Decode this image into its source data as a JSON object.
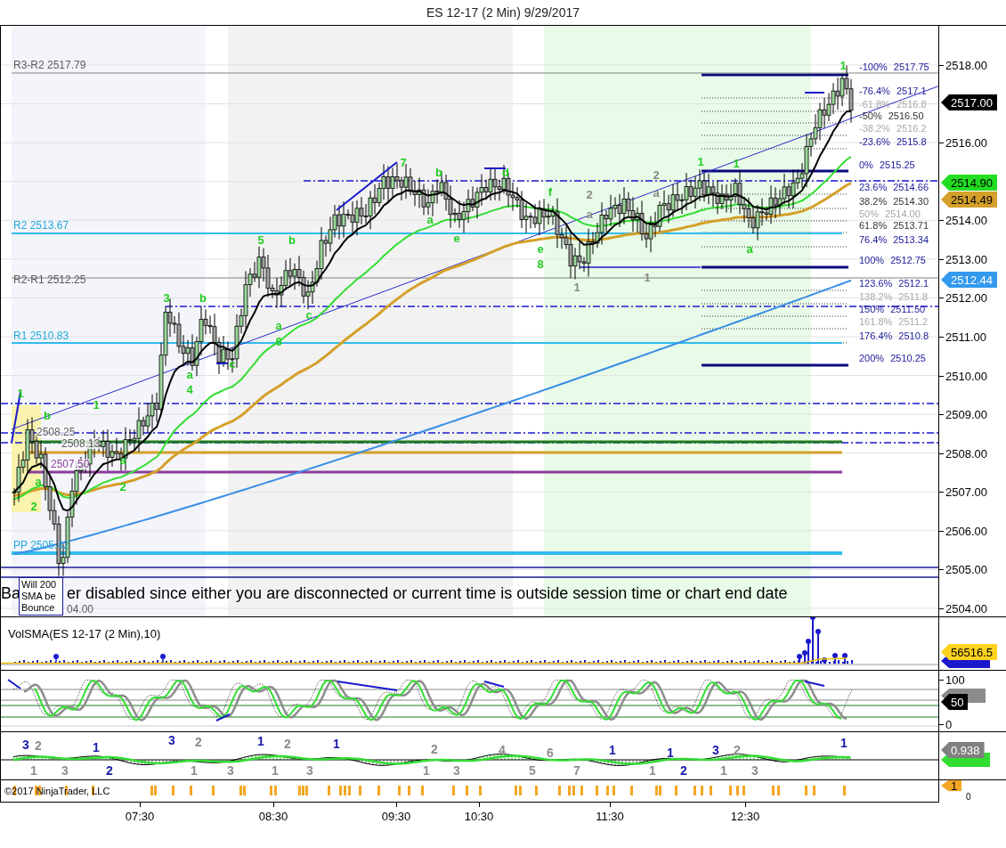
{
  "window": {
    "title": "ES 12-17 (2 Min)  9/29/2017"
  },
  "price_panel": {
    "level_labels": [
      {
        "text": "R3-R2 2517.79",
        "kind": "midpoint"
      },
      {
        "text": "R2 2513.67",
        "kind": "pivot"
      },
      {
        "text": "R2-R1 2512.25",
        "kind": "midpoint"
      },
      {
        "text": "R1 2510.83",
        "kind": "pivot"
      },
      {
        "text": "2508.25",
        "kind": "midpoint"
      },
      {
        "text": "2508.13",
        "kind": "midpoint"
      },
      {
        "text": "2507.50",
        "kind": "prior"
      },
      {
        "text": "PP 2505.42",
        "kind": "pivot"
      },
      {
        "text": "04.00",
        "kind": "midpoint"
      }
    ],
    "fib_labels": [
      {
        "text": "-100% 2517.75",
        "kind": "major"
      },
      {
        "text": "-76.4% 2517.1",
        "kind": "major"
      },
      {
        "text": "-61.8% 2516.8",
        "kind": "minor"
      },
      {
        "text": "-50% 2516.50",
        "kind": "mid"
      },
      {
        "text": "-38.2% 2516.2",
        "kind": "minor"
      },
      {
        "text": "-23.6% 2515.8",
        "kind": "major"
      },
      {
        "text": "0% 2515.25",
        "kind": "major"
      },
      {
        "text": "23.6% 2514.66",
        "kind": "major"
      },
      {
        "text": "38.2% 2514.30",
        "kind": "mid"
      },
      {
        "text": "50% 2514.00",
        "kind": "minor"
      },
      {
        "text": "61.8% 2513.71",
        "kind": "mid"
      },
      {
        "text": "76.4% 2513.34",
        "kind": "major"
      },
      {
        "text": "100% 2512.75",
        "kind": "major"
      },
      {
        "text": "123.6% 2512.1",
        "kind": "major"
      },
      {
        "text": "138.2% 2511.8",
        "kind": "minor"
      },
      {
        "text": "150% 2511.50",
        "kind": "major"
      },
      {
        "text": "161.8% 2511.2",
        "kind": "minor"
      },
      {
        "text": "176.4% 2510.8",
        "kind": "major"
      },
      {
        "text": "200% 2510.25",
        "kind": "major"
      }
    ],
    "wave_labels": [
      {
        "text": "1",
        "kind": "primary"
      },
      {
        "text": "b",
        "kind": "primary"
      },
      {
        "text": "a",
        "kind": "primary"
      },
      {
        "text": "2",
        "kind": "primary"
      },
      {
        "text": "1",
        "kind": "primary"
      },
      {
        "text": "a",
        "kind": "primary"
      },
      {
        "text": "2",
        "kind": "primary"
      },
      {
        "text": "3",
        "kind": "primary"
      },
      {
        "text": "b",
        "kind": "primary"
      },
      {
        "text": "a",
        "kind": "primary"
      },
      {
        "text": "4",
        "kind": "primary"
      },
      {
        "text": "c",
        "kind": "primary"
      },
      {
        "text": "5",
        "kind": "primary"
      },
      {
        "text": "b",
        "kind": "primary"
      },
      {
        "text": "a",
        "kind": "primary"
      },
      {
        "text": "6",
        "kind": "primary"
      },
      {
        "text": "c",
        "kind": "primary"
      },
      {
        "text": "7",
        "kind": "primary"
      },
      {
        "text": "b",
        "kind": "primary"
      },
      {
        "text": "a",
        "kind": "primary"
      },
      {
        "text": "e",
        "kind": "primary"
      },
      {
        "text": "d",
        "kind": "primary"
      },
      {
        "text": "e",
        "kind": "primary"
      },
      {
        "text": "8",
        "kind": "primary"
      },
      {
        "text": "f",
        "kind": "primary"
      },
      {
        "text": "1",
        "kind": "secondary"
      },
      {
        "text": "2",
        "kind": "secondary"
      },
      {
        "text": "a",
        "kind": "secondary"
      },
      {
        "text": "1",
        "kind": "secondary"
      },
      {
        "text": "2",
        "kind": "secondary"
      },
      {
        "text": "a",
        "kind": "secondary"
      },
      {
        "text": "1",
        "kind": "primary"
      },
      {
        "text": "1",
        "kind": "primary"
      },
      {
        "text": "a",
        "kind": "primary"
      },
      {
        "text": "1",
        "kind": "primary"
      }
    ],
    "note": {
      "lines": [
        "Will 200",
        "SMA be",
        "Bounce"
      ]
    },
    "banner": {
      "prefix": "Ba",
      "text": "er disabled since either you are disconnected or current time is outside session time or chart end date"
    },
    "price_axis": [
      "2518.00",
      "2516.00",
      "2514.00",
      "2513.00",
      "2512.00",
      "2511.00",
      "2510.00",
      "2509.00",
      "2508.00",
      "2507.00",
      "2506.00",
      "2505.00",
      "2504.00"
    ],
    "price_tags": [
      {
        "text": "2517.00",
        "color": "#000000"
      },
      {
        "text": "2514.90",
        "color": "#22dd22"
      },
      {
        "text": "2514.49",
        "color": "#d4a02a"
      },
      {
        "text": "2512.44",
        "color": "#3399ee"
      }
    ]
  },
  "volume_panel": {
    "title": "VolSMA(ES 12-17 (2 Min),10)",
    "tags": [
      {
        "text": "56516.5",
        "color": "#ffd21f"
      }
    ]
  },
  "stoch_panel": {
    "axis": [
      "100",
      "0"
    ],
    "tags": [
      {
        "text": "50",
        "color": "#000000"
      }
    ]
  },
  "osc_panel": {
    "labels": [
      {
        "text": "3",
        "kind": "primary"
      },
      {
        "text": "2",
        "kind": "secondary"
      },
      {
        "text": "1",
        "kind": "primary"
      },
      {
        "text": "3",
        "kind": "primary"
      },
      {
        "text": "2",
        "kind": "secondary"
      },
      {
        "text": "1",
        "kind": "primary"
      },
      {
        "text": "2",
        "kind": "secondary"
      },
      {
        "text": "1",
        "kind": "primary"
      },
      {
        "text": "2",
        "kind": "secondary"
      },
      {
        "text": "4",
        "kind": "secondary"
      },
      {
        "text": "6",
        "kind": "secondary"
      },
      {
        "text": "1",
        "kind": "primary"
      },
      {
        "text": "1",
        "kind": "primary"
      },
      {
        "text": "3",
        "kind": "primary"
      },
      {
        "text": "2",
        "kind": "secondary"
      },
      {
        "text": "1",
        "kind": "primary"
      },
      {
        "text": "1",
        "kind": "secondary"
      },
      {
        "text": "3",
        "kind": "secondary"
      },
      {
        "text": "2",
        "kind": "primary"
      },
      {
        "text": "1",
        "kind": "secondary"
      },
      {
        "text": "3",
        "kind": "secondary"
      },
      {
        "text": "1",
        "kind": "secondary"
      },
      {
        "text": "3",
        "kind": "secondary"
      },
      {
        "text": "1",
        "kind": "secondary"
      },
      {
        "text": "3",
        "kind": "secondary"
      },
      {
        "text": "5",
        "kind": "secondary"
      },
      {
        "text": "7",
        "kind": "secondary"
      },
      {
        "text": "1",
        "kind": "secondary"
      },
      {
        "text": "2",
        "kind": "primary"
      },
      {
        "text": "1",
        "kind": "secondary"
      },
      {
        "text": "3",
        "kind": "secondary"
      }
    ],
    "tags": [
      {
        "text": "0.938",
        "color": "#808080"
      }
    ]
  },
  "signal_panel": {
    "copyright": "©2017 NinjaTrader, LLC",
    "axis": [
      "0"
    ],
    "tags": [
      {
        "text": "1",
        "color": "#f5a623"
      }
    ]
  },
  "time_axis": [
    "07:30",
    "08:30",
    "09:30",
    "10:30",
    "11:30",
    "12:30"
  ]
}
